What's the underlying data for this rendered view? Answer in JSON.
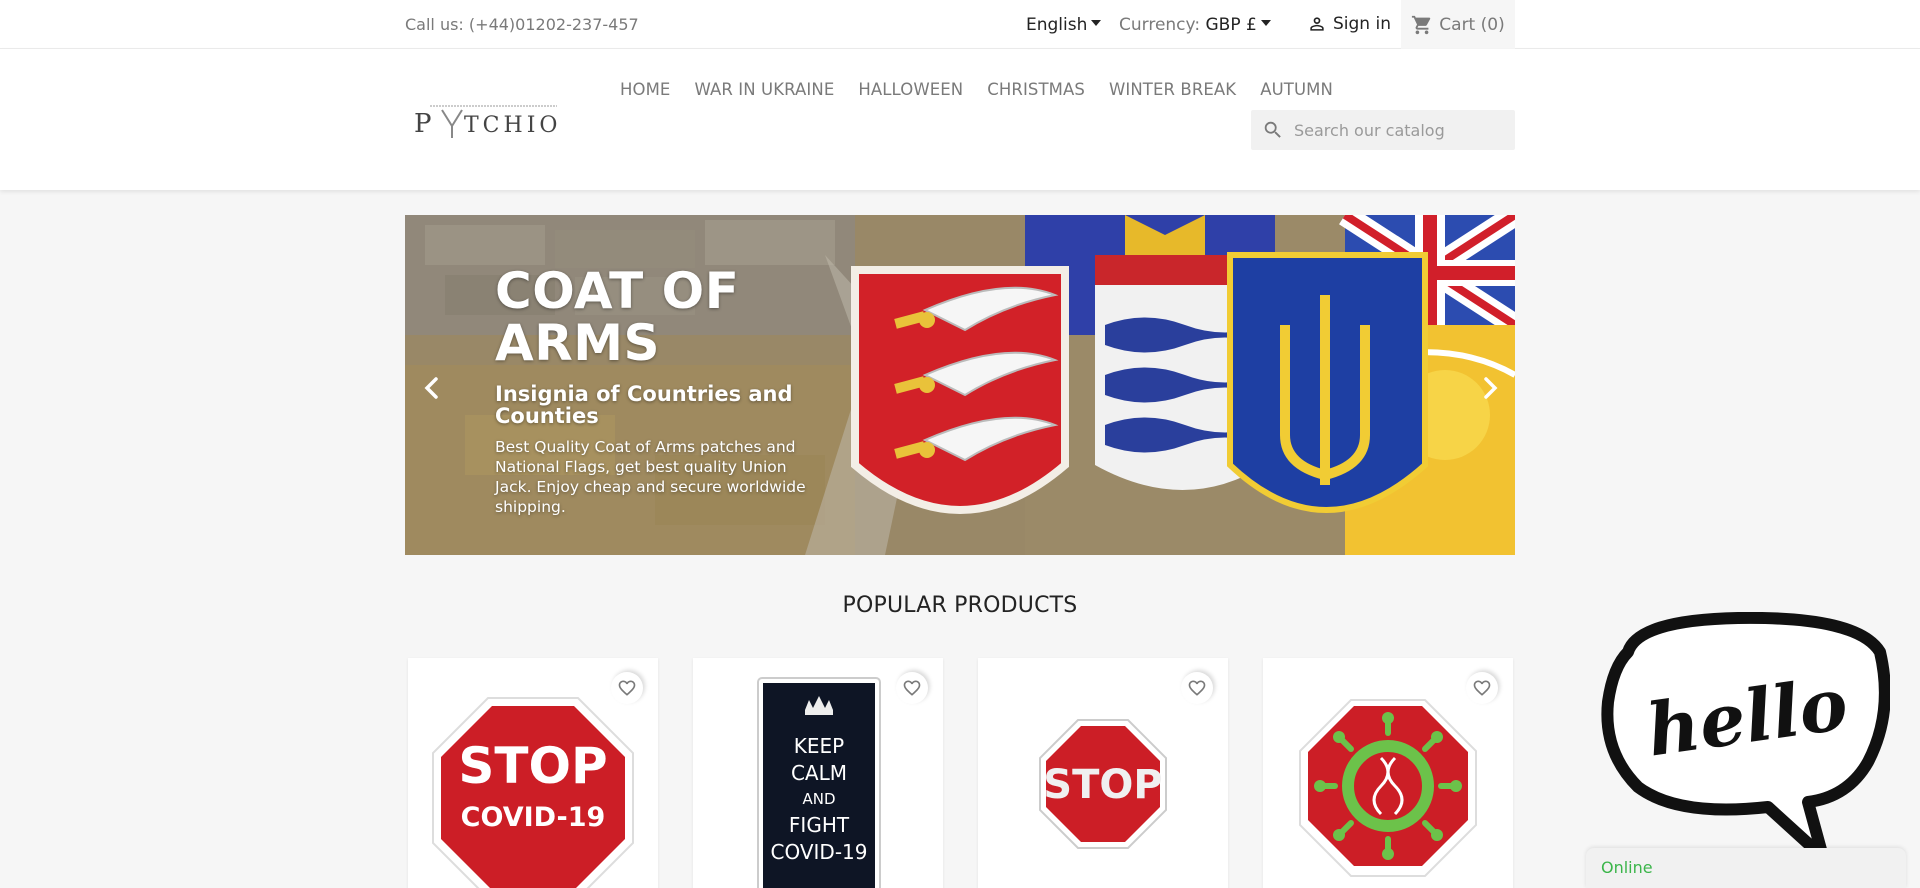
{
  "topbar": {
    "call_label": "Call us:",
    "phone": "(+44)01202-237-457",
    "language": "English",
    "currency_label": "Currency:",
    "currency_value": "GBP £",
    "signin": "Sign in",
    "cart": "Cart (0)"
  },
  "header": {
    "logo_text": "PATCHION",
    "nav": [
      "HOME",
      "WAR IN UKRAINE",
      "HALLOWEEN",
      "CHRISTMAS",
      "WINTER BREAK",
      "AUTUMN"
    ],
    "search_placeholder": "Search our catalog"
  },
  "slider": {
    "title": "COAT OF ARMS",
    "subtitle": "Insignia of Countries and Counties",
    "description": "Best Quality Coat of Arms patches and National Flags, get best quality Union Jack. Enjoy cheap and secure worldwide shipping."
  },
  "popular": {
    "title": "POPULAR PRODUCTS",
    "products": [
      {
        "name": "STOP COVID-19",
        "line1": "STOP",
        "line2": "COVID-19"
      },
      {
        "name": "KEEP CALM AND FIGHT COVID-19",
        "line1": "KEEP",
        "line2": "CALM",
        "line3": "AND",
        "line4": "FIGHT",
        "line5": "COVID-19"
      },
      {
        "name": "STOP",
        "line1": "STOP"
      },
      {
        "name": "Virus stop sign",
        "line1": ""
      }
    ]
  },
  "chat": {
    "bubble_text": "hello",
    "status": "Online"
  },
  "icons": {
    "user": "user-icon",
    "cart": "shopping-cart-icon",
    "search": "search-icon",
    "prev": "chevron-left-icon",
    "next": "chevron-right-icon",
    "favorite": "heart-icon"
  },
  "colors": {
    "accent": "#24b9d7",
    "online": "#3bb54a",
    "stop_red": "#cc1e26"
  }
}
